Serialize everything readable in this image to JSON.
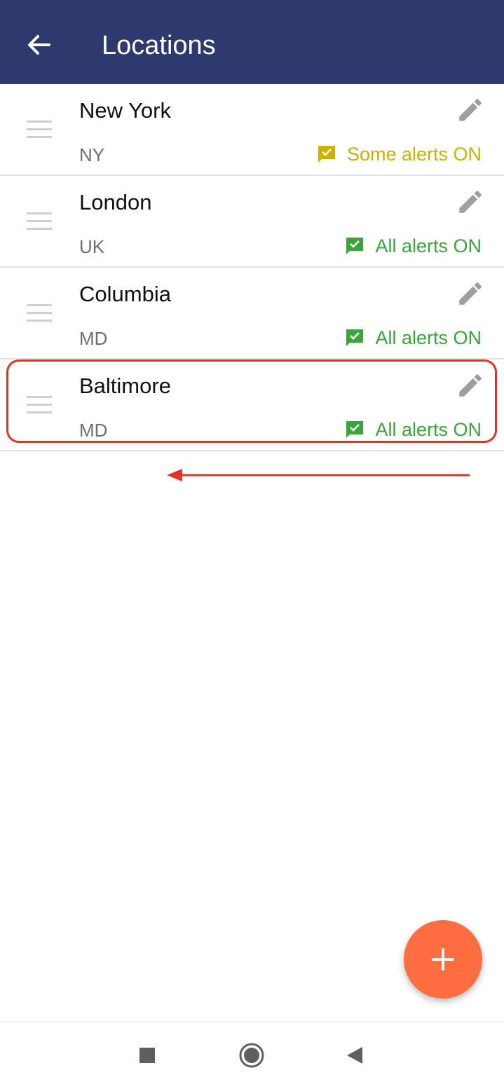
{
  "appbar": {
    "title": "Locations",
    "back_icon": "arrow-left-icon"
  },
  "locations": [
    {
      "name": "New York",
      "region": "NY",
      "status": "Some alerts ON",
      "status_color": "#c9b10a"
    },
    {
      "name": "London",
      "region": "UK",
      "status": "All alerts ON",
      "status_color": "#3aa53a"
    },
    {
      "name": "Columbia",
      "region": "MD",
      "status": "All alerts ON",
      "status_color": "#3aa53a"
    },
    {
      "name": "Baltimore",
      "region": "MD",
      "status": "All alerts ON",
      "status_color": "#3aa53a"
    }
  ],
  "colors": {
    "appbar": "#2e3a6e",
    "fab": "#ff6e40",
    "annotation": "#e53227"
  },
  "fab": {
    "icon": "plus-icon"
  },
  "navbar": {
    "icons": [
      "recents-square-icon",
      "home-circle-icon",
      "back-triangle-icon"
    ]
  }
}
